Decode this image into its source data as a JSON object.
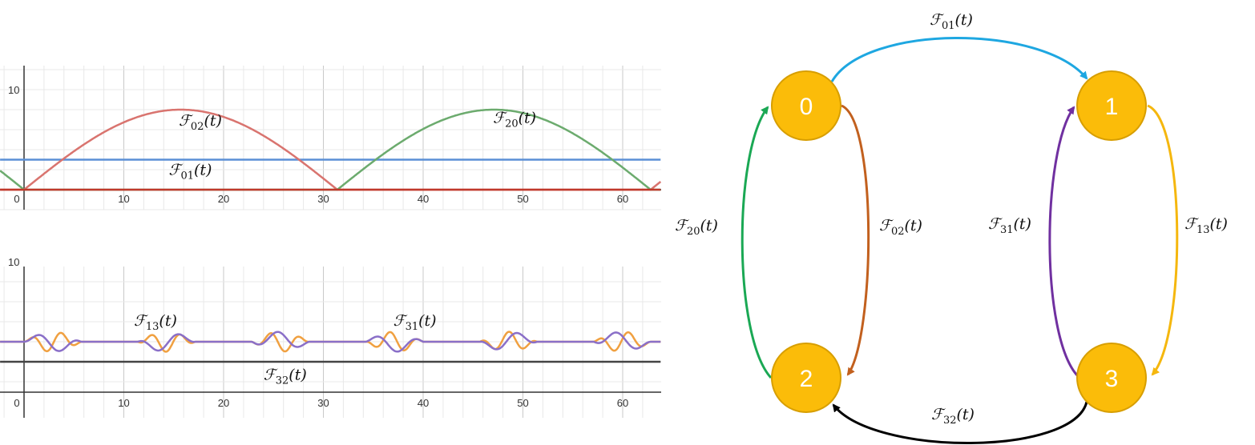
{
  "chart_data": [
    {
      "type": "line",
      "title": "",
      "xlabel": "",
      "ylabel": "",
      "xlim": [
        -2.5,
        64.5
      ],
      "ylim": [
        -2,
        13
      ],
      "grid": true,
      "x_ticks": [
        0,
        10,
        20,
        30,
        40,
        50,
        60
      ],
      "y_ticks": [
        10
      ],
      "series": [
        {
          "id": "F01",
          "color": "#5b8fd6",
          "kind": "constant",
          "value": 3
        },
        {
          "id": "F02",
          "color": "#d9746f",
          "kind": "half-sine-bumps",
          "peak": 8,
          "period": 31.4,
          "start": 0
        },
        {
          "id": "F20",
          "color": "#6cab6e",
          "kind": "half-sine-bumps",
          "peak": 8,
          "period": 31.4,
          "start": 31.4
        },
        {
          "id": "F10",
          "color": "#c0392b",
          "kind": "constant",
          "value": 0
        }
      ],
      "curve_labels": [
        {
          "series": "F02",
          "main": "ℱ",
          "sub": "02",
          "tail": "(t)",
          "at": [
            15.5,
            6.4
          ]
        },
        {
          "series": "F20",
          "main": "ℱ",
          "sub": "20",
          "tail": "(t)",
          "at": [
            47,
            6.7
          ]
        },
        {
          "series": "F01",
          "main": "ℱ",
          "sub": "01",
          "tail": "(t)",
          "at": [
            14.5,
            1.5
          ]
        }
      ]
    },
    {
      "type": "line",
      "title": "",
      "xlabel": "",
      "ylabel": "",
      "xlim": [
        -2.5,
        64.5
      ],
      "ylim": [
        -3,
        13
      ],
      "grid": true,
      "x_ticks": [
        0,
        10,
        20,
        30,
        40,
        50,
        60
      ],
      "y_ticks": [
        10
      ],
      "series": [
        {
          "id": "F13",
          "color": "#f0a040",
          "kind": "oscillation",
          "base": 2,
          "amplitude": 1,
          "frequency": 2.1
        },
        {
          "id": "F31",
          "color": "#8a6fc8",
          "kind": "oscillation",
          "base": 2,
          "amplitude": 1,
          "frequency": 1.3
        },
        {
          "id": "F32",
          "color": "#444444",
          "kind": "constant",
          "value": 0
        }
      ],
      "curve_labels": [
        {
          "series": "F13",
          "main": "ℱ",
          "sub": "13",
          "tail": "(t)",
          "at": [
            11,
            3.6
          ]
        },
        {
          "series": "F31",
          "main": "ℱ",
          "sub": "31",
          "tail": "(t)",
          "at": [
            37,
            3.6
          ]
        },
        {
          "series": "F32",
          "main": "ℱ",
          "sub": "32",
          "tail": "(t)",
          "at": [
            24,
            -1.8
          ]
        }
      ]
    }
  ],
  "diagram": {
    "node_color": "#fbbc09",
    "node_border": "#d79e00",
    "nodes": [
      {
        "id": "0",
        "label": "0"
      },
      {
        "id": "1",
        "label": "1"
      },
      {
        "id": "2",
        "label": "2"
      },
      {
        "id": "3",
        "label": "3"
      }
    ],
    "edges": [
      {
        "from": "0",
        "to": "1",
        "color": "#1ea7e1",
        "main": "ℱ",
        "sub": "01",
        "tail": "(t)"
      },
      {
        "from": "0",
        "to": "2",
        "color": "#c2601e",
        "main": "ℱ",
        "sub": "02",
        "tail": "(t)"
      },
      {
        "from": "2",
        "to": "0",
        "color": "#1aa854",
        "main": "ℱ",
        "sub": "20",
        "tail": "(t)"
      },
      {
        "from": "1",
        "to": "3",
        "color": "#f5b70e",
        "main": "ℱ",
        "sub": "13",
        "tail": "(t)"
      },
      {
        "from": "3",
        "to": "1",
        "color": "#7030a0",
        "main": "ℱ",
        "sub": "31",
        "tail": "(t)"
      },
      {
        "from": "3",
        "to": "2",
        "color": "#000000",
        "main": "ℱ",
        "sub": "32",
        "tail": "(t)"
      }
    ]
  }
}
